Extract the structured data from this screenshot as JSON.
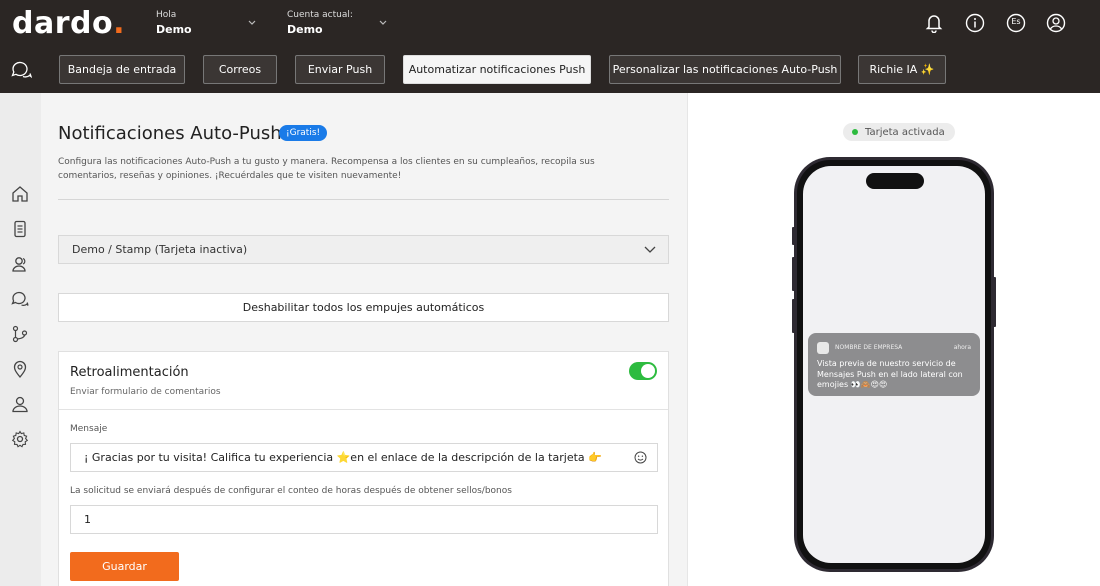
{
  "header": {
    "logo_text": "dardo",
    "logo_dot": ".",
    "greeting_label": "Hola",
    "greeting_value": "Demo",
    "account_label": "Cuenta actual:",
    "account_value": "Demo",
    "lang_badge": "Es",
    "icons": [
      "bell-icon",
      "info-icon",
      "language-icon",
      "user-icon"
    ]
  },
  "nav": {
    "tabs": [
      {
        "label": "Bandeja de entrada"
      },
      {
        "label": "Correos"
      },
      {
        "label": "Enviar Push"
      },
      {
        "label": "Automatizar notificaciones Push"
      },
      {
        "label": "Personalizar las notificaciones Auto-Push"
      },
      {
        "label": "Richie IA ✨"
      }
    ],
    "active_tab": "Automatizar notificaciones Push"
  },
  "sidebar": {
    "icons": [
      "home-icon",
      "wallet-icon",
      "customers-icon",
      "chat-icon",
      "git-branch-icon",
      "location-pin-icon",
      "user-plus-icon",
      "settings-icon"
    ]
  },
  "main": {
    "title": "Notificaciones Auto-Push",
    "badge": "¡Gratis!",
    "description": "Configura las notificaciones Auto-Push a tu gusto y manera. Recompensa a los clientes en su cumpleaños, recopila sus comentarios, reseñas y opiniones. ¡Recuérdales que te visiten nuevamente!",
    "card_select": "Demo / Stamp (Tarjeta inactiva)",
    "disable_all_label": "Deshabilitar todos los empujes automáticos",
    "feedback": {
      "title": "Retroalimentación",
      "subtitle": "Enviar formulario de comentarios",
      "enabled": true,
      "message_label": "Mensaje",
      "message_value": "¡ Gracias por tu visita! Califica tu experiencia ⭐en el enlace de la descripción de la tarjeta 👉",
      "delay_label": "La solicitud se enviará después de configurar el conteo de horas después de obtener sellos/bonos",
      "delay_value": "1",
      "save_label": "Guardar"
    }
  },
  "preview": {
    "status": "Tarjeta activada",
    "notification": {
      "company": "NOMBRE DE EMPRESA",
      "time": "ahora",
      "body": "Vista previa de nuestro servicio de Mensajes Push en el lado lateral con emojies 👀🙈😍😍"
    }
  },
  "colors": {
    "accent": "#f26b1d",
    "header_bg": "#2b2624",
    "badge_blue": "#1a7be8",
    "toggle_green": "#2dbb3f"
  }
}
